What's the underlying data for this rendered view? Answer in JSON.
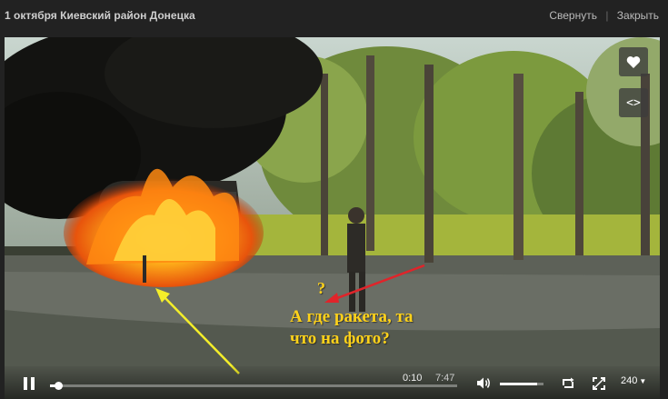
{
  "window": {
    "title": "1 октября Киевский район Донецка",
    "collapse_label": "Свернуть",
    "close_label": "Закрыть"
  },
  "video": {
    "caption_question": "?",
    "caption_line1": "А где ракета, та",
    "caption_line2": "что на фото?",
    "caption_color": "#ffd21a",
    "arrow_colors": {
      "red": "#e0242a",
      "yellow": "#f4ee2a"
    }
  },
  "side_buttons": {
    "like_icon": "heart-icon",
    "embed_icon": "code-icon",
    "embed_text": "<>"
  },
  "controls": {
    "state": "playing",
    "current_time": "0:10",
    "duration": "7:47",
    "progress_fraction": 0.021,
    "volume_fraction": 0.85,
    "quality": "240",
    "icons": [
      "pause-icon",
      "volume-icon",
      "loop-icon",
      "fullscreen-icon"
    ]
  }
}
